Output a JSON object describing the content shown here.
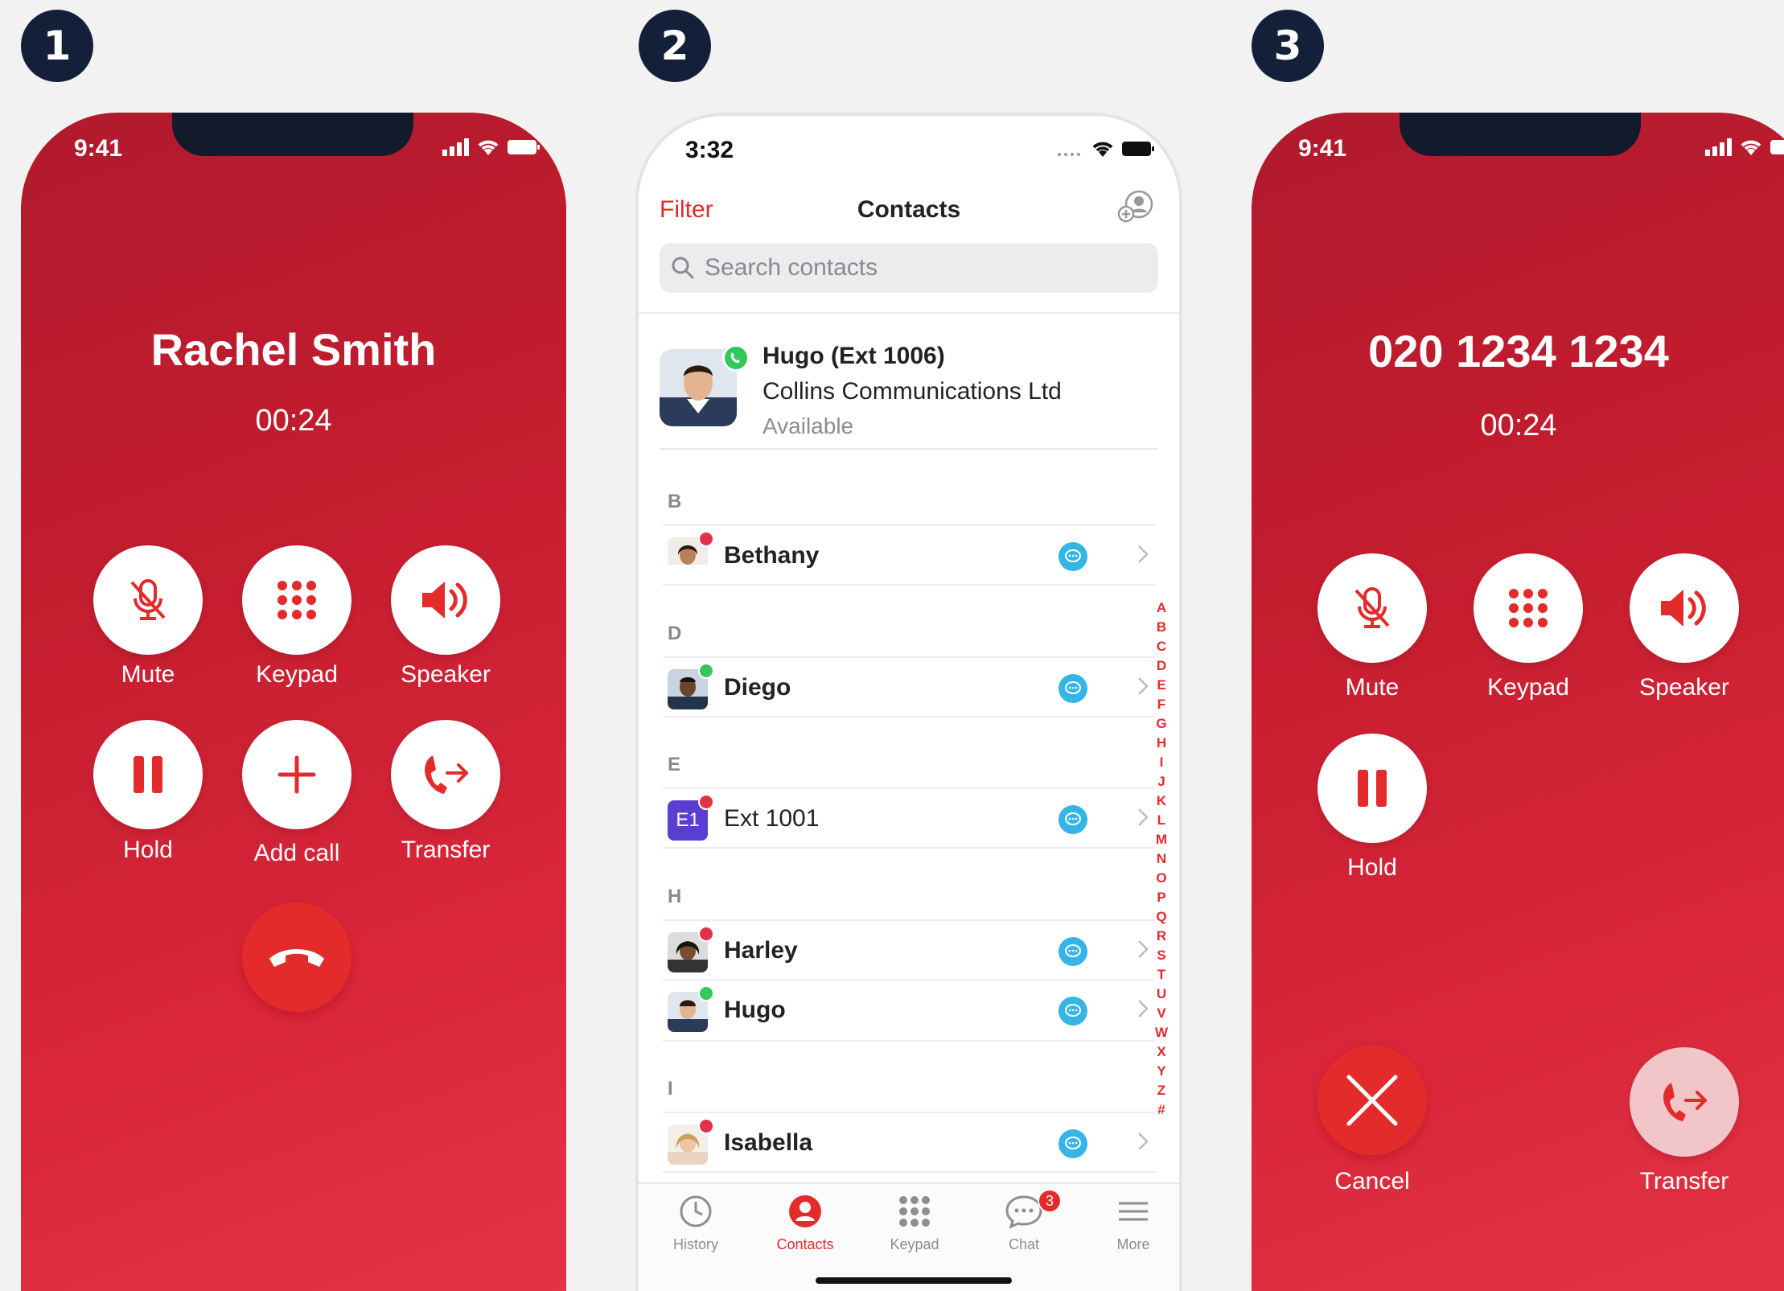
{
  "steps": [
    "1",
    "2",
    "3"
  ],
  "screen1": {
    "time": "9:41",
    "caller_name": "Rachel Smith",
    "timer": "00:24",
    "buttons": {
      "mute": "Mute",
      "keypad": "Keypad",
      "speaker": "Speaker",
      "hold": "Hold",
      "add_call": "Add call",
      "transfer": "Transfer"
    }
  },
  "screen2": {
    "time": "3:32",
    "header": {
      "filter": "Filter",
      "title": "Contacts"
    },
    "search": {
      "placeholder": "Search contacts"
    },
    "me": {
      "name": "Hugo (Ext 1006)",
      "company": "Collins Communications Ltd",
      "status": "Available"
    },
    "sections": [
      {
        "letter": "B",
        "contacts": [
          {
            "name": "Bethany",
            "presence": "busy"
          }
        ]
      },
      {
        "letter": "D",
        "contacts": [
          {
            "name": "Diego",
            "presence": "available"
          }
        ]
      },
      {
        "letter": "E",
        "contacts": [
          {
            "name": "Ext 1001",
            "presence": "busy",
            "initials": "E1"
          }
        ]
      },
      {
        "letter": "H",
        "contacts": [
          {
            "name": "Harley",
            "presence": "busy"
          },
          {
            "name": "Hugo",
            "presence": "available"
          }
        ]
      },
      {
        "letter": "I",
        "contacts": [
          {
            "name": "Isabella",
            "presence": "busy"
          }
        ]
      }
    ],
    "alphabet": [
      "A",
      "B",
      "C",
      "D",
      "E",
      "F",
      "G",
      "H",
      "I",
      "J",
      "K",
      "L",
      "M",
      "N",
      "O",
      "P",
      "Q",
      "R",
      "S",
      "T",
      "U",
      "V",
      "W",
      "X",
      "Y",
      "Z",
      "#"
    ],
    "tabs": [
      {
        "label": "History",
        "icon": "clock-icon"
      },
      {
        "label": "Contacts",
        "icon": "person-icon",
        "active": true
      },
      {
        "label": "Keypad",
        "icon": "keypad-icon"
      },
      {
        "label": "Chat",
        "icon": "chat-bubble-icon",
        "badge": "3"
      },
      {
        "label": "More",
        "icon": "menu-icon"
      }
    ]
  },
  "screen3": {
    "time": "9:41",
    "number": "020 1234 1234",
    "timer": "00:24",
    "buttons": {
      "mute": "Mute",
      "keypad": "Keypad",
      "speaker": "Speaker",
      "hold": "Hold",
      "cancel": "Cancel",
      "transfer": "Transfer"
    }
  },
  "colors": {
    "brand_red": "#e32b2b",
    "badge_navy": "#14203a",
    "chat_blue": "#35b5e6",
    "presence_available": "#34c759",
    "presence_busy": "#e0334a"
  }
}
